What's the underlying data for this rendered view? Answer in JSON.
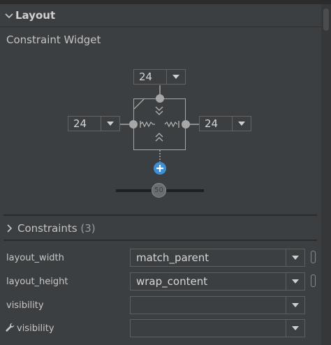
{
  "section": {
    "title": "Layout",
    "subtitle": "Constraint Widget"
  },
  "constraint_widget": {
    "top_margin": "24",
    "left_margin": "24",
    "right_margin": "24",
    "bias": "50"
  },
  "constraints": {
    "label": "Constraints",
    "count": "(3)"
  },
  "attributes": [
    {
      "label": "layout_width",
      "value": "match_parent"
    },
    {
      "label": "layout_height",
      "value": "wrap_content"
    },
    {
      "label": "visibility",
      "value": ""
    },
    {
      "label": "visibility",
      "value": ""
    }
  ],
  "colors": {
    "background": "#3c3f41",
    "accent_blue": "#3d8fd8",
    "line": "#a7a7a7"
  }
}
